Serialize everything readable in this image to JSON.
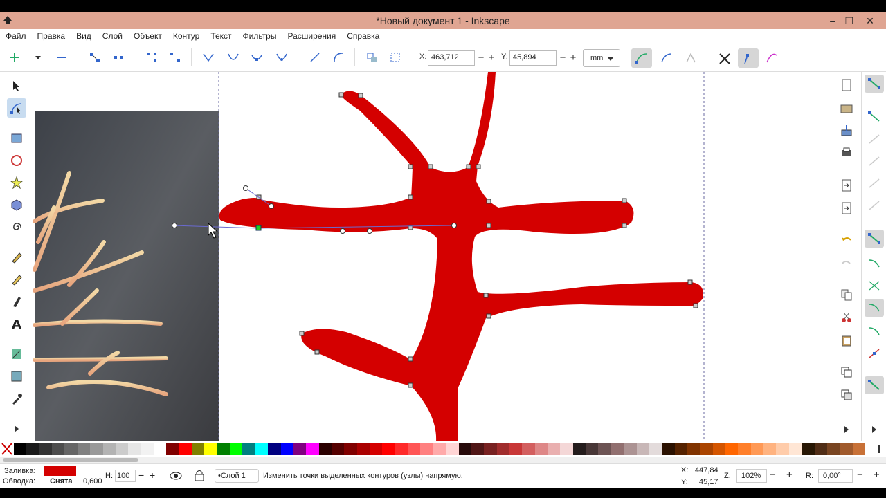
{
  "window": {
    "title": "*Новый документ 1 - Inkscape",
    "minimize": "–",
    "maximize": "❐",
    "close": "✕"
  },
  "menu": [
    "Файл",
    "Правка",
    "Вид",
    "Слой",
    "Объект",
    "Контур",
    "Текст",
    "Фильтры",
    "Расширения",
    "Справка"
  ],
  "controls": {
    "x_label": "X:",
    "x_value": "463,712",
    "y_label": "Y:",
    "y_value": "45,894",
    "unit": "mm",
    "minus": "−",
    "plus": "+"
  },
  "status": {
    "fill_label": "Заливка:",
    "stroke_label": "Обводка:",
    "stroke_value": "Снята",
    "stroke_width": "0,600",
    "fill_color": "#d40000",
    "h_label": "Н:",
    "h_value": "100",
    "layer": "•Слой 1",
    "message": "Изменить точки выделенных контуров (узлы) напрямую.",
    "x_label": "X:",
    "x_value": "447,84",
    "y_label": "Y:",
    "y_value": "45,17",
    "z_label": "Z:",
    "zoom": "102%",
    "r_label": "R:",
    "rotation": "0,00°"
  },
  "palette": [
    "#000000",
    "#1a1a1a",
    "#333333",
    "#4d4d4d",
    "#666666",
    "#808080",
    "#999999",
    "#b3b3b3",
    "#cccccc",
    "#e6e6e6",
    "#f2f2f2",
    "#ffffff",
    "#800000",
    "#ff0000",
    "#808000",
    "#ffff00",
    "#008000",
    "#00ff00",
    "#008080",
    "#00ffff",
    "#000080",
    "#0000ff",
    "#800080",
    "#ff00ff",
    "#2b0000",
    "#550000",
    "#800000",
    "#aa0000",
    "#d40000",
    "#ff0000",
    "#ff2a2a",
    "#ff5555",
    "#ff8080",
    "#ffaaaa",
    "#ffd5d5",
    "#280b0b",
    "#501616",
    "#782121",
    "#a02c2c",
    "#c83737",
    "#d35f5f",
    "#de8787",
    "#e9afaf",
    "#f4d7d7",
    "#241c1c",
    "#483737",
    "#6c5353",
    "#916f6f",
    "#ac9393",
    "#c8b7b7",
    "#e3dbdb",
    "#2b1100",
    "#552200",
    "#803300",
    "#aa4400",
    "#d45500",
    "#ff6600",
    "#ff7f2a",
    "#ff9955",
    "#ffb380",
    "#ffccaa",
    "#ffe6d5",
    "#281704",
    "#502d16",
    "#784421",
    "#a05a2c",
    "#c87137"
  ],
  "accent_red": "#d40000"
}
